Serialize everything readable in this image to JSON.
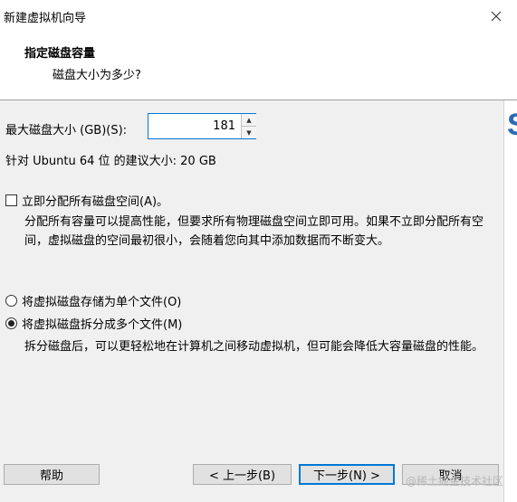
{
  "window": {
    "title": "新建虚拟机向导"
  },
  "header": {
    "title": "指定磁盘容量",
    "subtitle": "磁盘大小为多少?"
  },
  "disk_size": {
    "label": "最大磁盘大小 (GB)(S):",
    "value": "181"
  },
  "recommendation": "针对 Ubuntu 64 位 的建议大小: 20 GB",
  "allocate_now": {
    "label": "立即分配所有磁盘空间(A)。",
    "checked": false,
    "description": "分配所有容量可以提高性能，但要求所有物理磁盘空间立即可用。如果不立即分配所有空间，虚拟磁盘的空间最初很小，会随着您向其中添加数据而不断变大。"
  },
  "storage_options": [
    {
      "label": "将虚拟磁盘存储为单个文件(O)",
      "selected": false
    },
    {
      "label": "将虚拟磁盘拆分成多个文件(M)",
      "selected": true
    }
  ],
  "split_description": "拆分磁盘后，可以更轻松地在计算机之间移动虚拟机，但可能会降低大容量磁盘的性能。",
  "buttons": {
    "help": "帮助",
    "back": "< 上一步(B)",
    "next": "下一步(N) >",
    "cancel": "取消"
  },
  "watermark": "@稀土掘金技术社区",
  "colors": {
    "accent": "#0078d7",
    "panel": "#f0f0f0",
    "header_bg": "#ffffff"
  }
}
